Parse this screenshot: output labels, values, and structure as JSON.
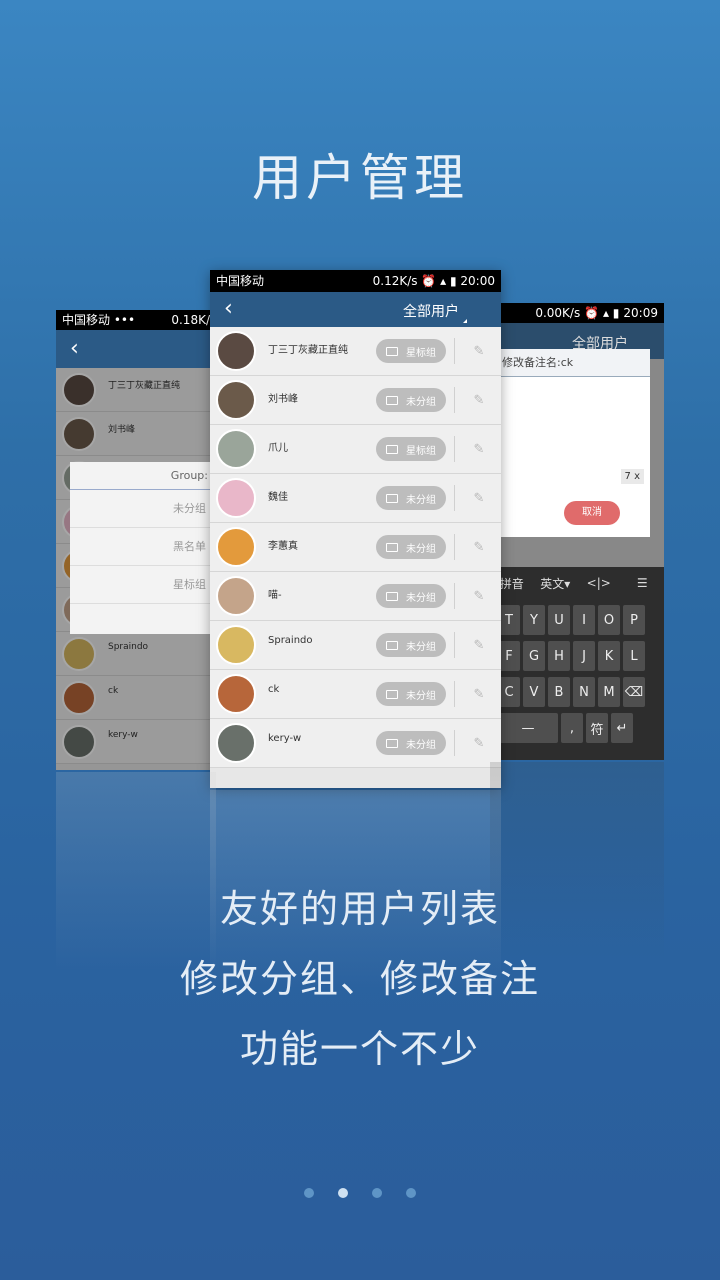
{
  "headline": "用户管理",
  "center_phone": {
    "status": {
      "carrier": "中国移动",
      "speed": "0.12K/s",
      "time": "20:00"
    },
    "title": "全部用户",
    "users": [
      {
        "name": "丁三丁灰藏正直纯",
        "group": "星标组",
        "avatar": "#5a4a42"
      },
      {
        "name": "刘书峰",
        "group": "未分组",
        "avatar": "#6b5a4a"
      },
      {
        "name": "爪儿",
        "group": "星标组",
        "avatar": "#9aa59a"
      },
      {
        "name": "魏佳",
        "group": "未分组",
        "avatar": "#e9b7c9"
      },
      {
        "name": "李蕙真",
        "group": "未分组",
        "avatar": "#e39a3c"
      },
      {
        "name": "喵-",
        "group": "未分组",
        "avatar": "#c4a48a"
      },
      {
        "name": "Spraindo",
        "group": "未分组",
        "avatar": "#d8b861"
      },
      {
        "name": "ck",
        "group": "未分组",
        "avatar": "#b7663a"
      },
      {
        "name": "kery-w",
        "group": "未分组",
        "avatar": "#69706a"
      }
    ]
  },
  "left_phone": {
    "status": {
      "carrier": "中国移动 •••",
      "speed": "0.18K/"
    },
    "users": [
      {
        "name": "丁三丁灰藏正直纯",
        "avatar": "#5a4a42"
      },
      {
        "name": "刘书峰",
        "avatar": "#6b5a4a"
      },
      {
        "name": "",
        "avatar": "#9aa59a"
      },
      {
        "name": "",
        "avatar": "#e9b7c9"
      },
      {
        "name": "",
        "avatar": "#e39a3c"
      },
      {
        "name": "",
        "avatar": "#c4a48a"
      },
      {
        "name": "Spraindo",
        "avatar": "#d8b861"
      },
      {
        "name": "ck",
        "avatar": "#b7663a"
      },
      {
        "name": "kery-w",
        "avatar": "#69706a"
      }
    ],
    "dialog": {
      "title": "Group:",
      "options": [
        "未分组",
        "黑名单",
        "星标组"
      ]
    }
  },
  "right_phone": {
    "status": {
      "speed": "0.00K/s",
      "time": "20:09"
    },
    "title": "全部用户",
    "dialog": {
      "title": "修改备注名:ck",
      "counter": "7 x",
      "cancel": "取消"
    },
    "keyboard": {
      "bar": [
        "拼音",
        "英文▾",
        "<|>",
        "☰"
      ],
      "row1": [
        "T",
        "Y",
        "U",
        "I",
        "O",
        "P"
      ],
      "row2": [
        "F",
        "G",
        "H",
        "J",
        "K",
        "L"
      ],
      "row3": [
        "C",
        "V",
        "B",
        "N",
        "M",
        "⌫"
      ],
      "row4": [
        "—",
        ",",
        "符",
        "↵"
      ]
    }
  },
  "taglines": [
    "友好的用户列表",
    "修改分组、修改备注",
    "功能一个不少"
  ],
  "pager": {
    "count": 4,
    "active": 1
  }
}
